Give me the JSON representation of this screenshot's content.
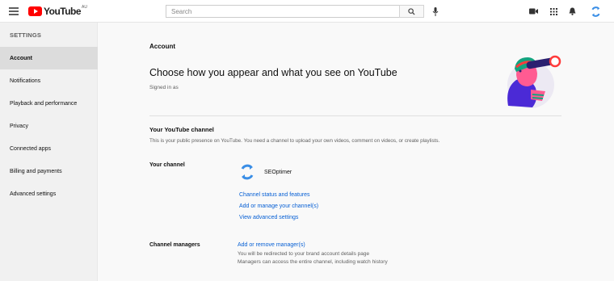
{
  "header": {
    "logo_text": "YouTube",
    "logo_region": "AU",
    "search_placeholder": "Search"
  },
  "icons": {
    "menu": "menu-icon",
    "search": "search-icon",
    "mic": "mic-icon",
    "create": "video-camera-icon",
    "apps": "apps-grid-icon",
    "notifications": "bell-icon",
    "account": "account-avatar-icon"
  },
  "sidebar": {
    "heading": "SETTINGS",
    "items": [
      {
        "label": "Account",
        "active": true
      },
      {
        "label": "Notifications"
      },
      {
        "label": "Playback and performance"
      },
      {
        "label": "Privacy"
      },
      {
        "label": "Connected apps"
      },
      {
        "label": "Billing and payments"
      },
      {
        "label": "Advanced settings"
      }
    ]
  },
  "main": {
    "section_label": "Account",
    "headline": "Choose how you appear and what you see on YouTube",
    "signed_in": "Signed in as",
    "channel_section": {
      "title": "Your YouTube channel",
      "description": "This is your public presence on YouTube. You need a channel to upload your own videos, comment on videos, or create playlists.",
      "your_channel_label": "Your channel",
      "channel_name": "SEOptimer",
      "links": [
        "Channel status and features",
        "Add or manage your channel(s)",
        "View advanced settings"
      ]
    },
    "managers": {
      "label": "Channel managers",
      "link": "Add or remove manager(s)",
      "note1": "You will be redirected to your brand account details page",
      "note2": "Managers can access the entire channel, including watch history"
    }
  },
  "colors": {
    "brand_red": "#ff0000",
    "link_blue": "#065fd4",
    "account_blue": "#3a8ee6"
  }
}
